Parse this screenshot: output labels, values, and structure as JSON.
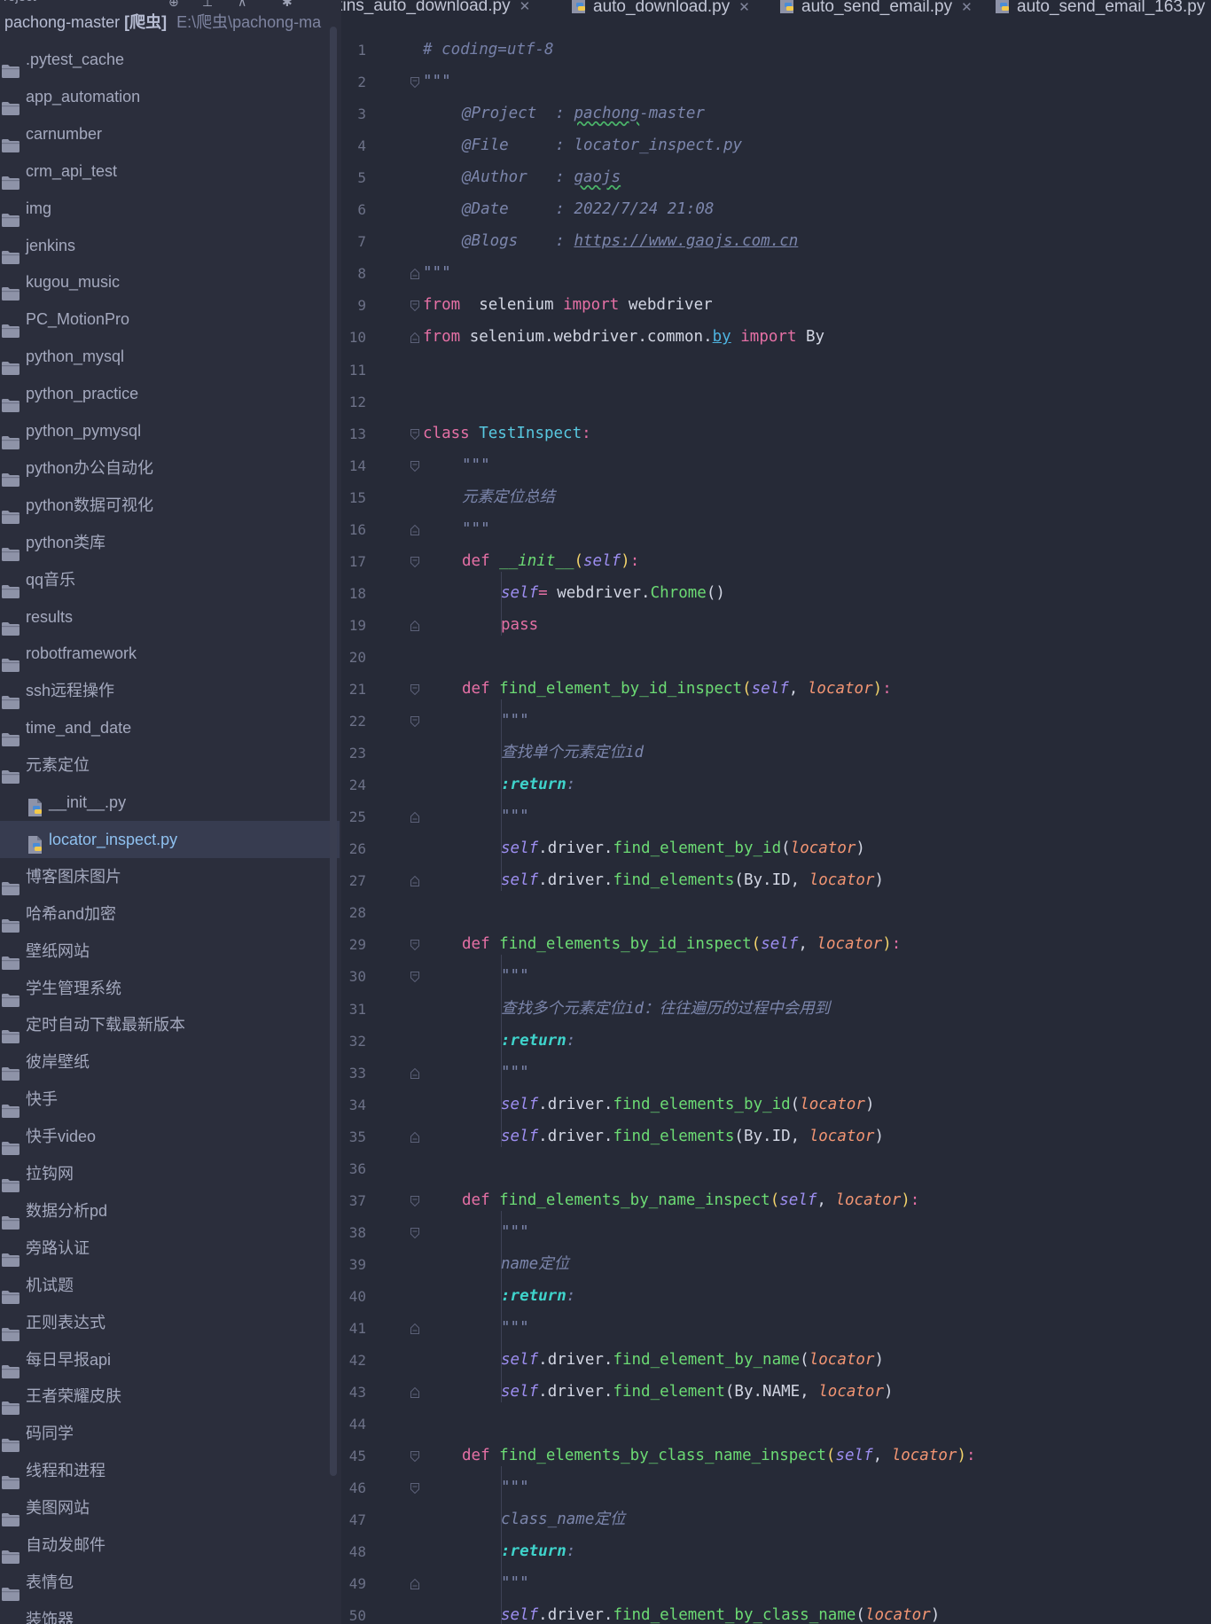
{
  "sidebar": {
    "header_label": "roject",
    "root": {
      "name": "pachong-master",
      "dir": "[爬虫]",
      "path": "E:\\爬虫\\pachong-ma"
    },
    "items": [
      {
        "label": ".pytest_cache",
        "type": "folder"
      },
      {
        "label": "app_automation",
        "type": "folder"
      },
      {
        "label": "carnumber",
        "type": "folder"
      },
      {
        "label": "crm_api_test",
        "type": "folder"
      },
      {
        "label": "img",
        "type": "folder"
      },
      {
        "label": "jenkins",
        "type": "folder"
      },
      {
        "label": "kugou_music",
        "type": "folder"
      },
      {
        "label": "PC_MotionPro",
        "type": "folder"
      },
      {
        "label": "python_mysql",
        "type": "folder"
      },
      {
        "label": "python_practice",
        "type": "folder"
      },
      {
        "label": "python_pymysql",
        "type": "folder"
      },
      {
        "label": "python办公自动化",
        "type": "folder"
      },
      {
        "label": "python数据可视化",
        "type": "folder"
      },
      {
        "label": "python类库",
        "type": "folder"
      },
      {
        "label": "qq音乐",
        "type": "folder"
      },
      {
        "label": "results",
        "type": "folder"
      },
      {
        "label": "robotframework",
        "type": "folder"
      },
      {
        "label": "ssh远程操作",
        "type": "folder"
      },
      {
        "label": "time_and_date",
        "type": "folder"
      },
      {
        "label": "元素定位",
        "type": "folder"
      },
      {
        "label": "__init__.py",
        "type": "file"
      },
      {
        "label": "locator_inspect.py",
        "type": "file",
        "selected": true
      },
      {
        "label": "博客图床图片",
        "type": "folder"
      },
      {
        "label": "哈希and加密",
        "type": "folder"
      },
      {
        "label": "壁纸网站",
        "type": "folder"
      },
      {
        "label": "学生管理系统",
        "type": "folder"
      },
      {
        "label": "定时自动下载最新版本",
        "type": "folder"
      },
      {
        "label": "彼岸壁纸",
        "type": "folder"
      },
      {
        "label": "快手",
        "type": "folder"
      },
      {
        "label": "快手video",
        "type": "folder"
      },
      {
        "label": "拉钩网",
        "type": "folder"
      },
      {
        "label": "数据分析pd",
        "type": "folder"
      },
      {
        "label": "旁路认证",
        "type": "folder"
      },
      {
        "label": "机试题",
        "type": "folder"
      },
      {
        "label": "正则表达式",
        "type": "folder"
      },
      {
        "label": "每日早报api",
        "type": "folder"
      },
      {
        "label": "王者荣耀皮肤",
        "type": "folder"
      },
      {
        "label": "码同学",
        "type": "folder"
      },
      {
        "label": "线程和进程",
        "type": "folder"
      },
      {
        "label": "美图网站",
        "type": "folder"
      },
      {
        "label": "自动发邮件",
        "type": "folder"
      },
      {
        "label": "表情包",
        "type": "folder"
      },
      {
        "label": "装饰器",
        "type": "folder"
      }
    ]
  },
  "tabs": [
    {
      "label": "kins_auto_download.py",
      "icon": false
    },
    {
      "label": "auto_download.py",
      "icon": true
    },
    {
      "label": "auto_send_email.py",
      "icon": true
    },
    {
      "label": "auto_send_email_163.py",
      "icon": true
    }
  ],
  "code_lines": [
    {
      "n": "1",
      "indent": 0,
      "fold": "",
      "tokens": [
        [
          "c-cmt",
          "# coding=utf-8"
        ]
      ]
    },
    {
      "n": "2",
      "indent": 0,
      "fold": "open",
      "tokens": [
        [
          "c-doc",
          "\"\"\""
        ]
      ]
    },
    {
      "n": "3",
      "indent": 1,
      "fold": "",
      "tokens": [
        [
          "c-doc",
          "@Project  : "
        ],
        [
          "c-doc c-wavy",
          "pachong"
        ],
        [
          "c-doc",
          "-master"
        ]
      ]
    },
    {
      "n": "4",
      "indent": 1,
      "fold": "",
      "tokens": [
        [
          "c-doc",
          "@File     : locator_inspect.py"
        ]
      ]
    },
    {
      "n": "5",
      "indent": 1,
      "fold": "",
      "tokens": [
        [
          "c-doc",
          "@Author   : "
        ],
        [
          "c-doc c-wavy",
          "gaojs"
        ]
      ]
    },
    {
      "n": "6",
      "indent": 1,
      "fold": "",
      "tokens": [
        [
          "c-doc",
          "@Date     : 2022/7/24 21:08"
        ]
      ]
    },
    {
      "n": "7",
      "indent": 1,
      "fold": "",
      "tokens": [
        [
          "c-doc",
          "@Blogs    : "
        ],
        [
          "c-doc c-link",
          "https://www.gaojs.com.cn"
        ]
      ]
    },
    {
      "n": "8",
      "indent": 0,
      "fold": "close",
      "tokens": [
        [
          "c-doc",
          "\"\"\""
        ]
      ]
    },
    {
      "n": "9",
      "indent": 0,
      "fold": "open",
      "tokens": [
        [
          "c-kw",
          "from"
        ],
        [
          "",
          "  selenium "
        ],
        [
          "c-kw",
          "import"
        ],
        [
          "",
          " webdriver"
        ]
      ]
    },
    {
      "n": "10",
      "indent": 0,
      "fold": "close",
      "tokens": [
        [
          "c-kw",
          "from"
        ],
        [
          "",
          " selenium.webdriver.common."
        ],
        [
          "c-uline",
          "by"
        ],
        [
          "",
          " "
        ],
        [
          "c-kw",
          "import"
        ],
        [
          "",
          " By"
        ]
      ]
    },
    {
      "n": "11",
      "indent": 0,
      "fold": "",
      "tokens": []
    },
    {
      "n": "12",
      "indent": 0,
      "fold": "",
      "tokens": []
    },
    {
      "n": "13",
      "indent": 0,
      "fold": "open",
      "tokens": [
        [
          "c-kw",
          "class"
        ],
        [
          "",
          " "
        ],
        [
          "c-cls",
          "TestInspect"
        ],
        [
          "c-kw",
          ":"
        ]
      ]
    },
    {
      "n": "14",
      "indent": 1,
      "fold": "open",
      "tokens": [
        [
          "c-doc",
          "\"\"\""
        ]
      ]
    },
    {
      "n": "15",
      "indent": 1,
      "fold": "",
      "tokens": [
        [
          "c-doc",
          "元素定位总结"
        ]
      ]
    },
    {
      "n": "16",
      "indent": 1,
      "fold": "close",
      "tokens": [
        [
          "c-doc",
          "\"\"\""
        ]
      ]
    },
    {
      "n": "17",
      "indent": 1,
      "fold": "open",
      "tokens": [
        [
          "c-kw",
          "def"
        ],
        [
          "",
          " "
        ],
        [
          "c-dunder",
          "__init__"
        ],
        [
          "c-paren",
          "("
        ],
        [
          "c-self",
          "self"
        ],
        [
          "c-paren",
          ")"
        ],
        [
          "c-kw",
          ":"
        ]
      ]
    },
    {
      "n": "18",
      "indent": 2,
      "fold": "",
      "tokens": [
        [
          "c-self",
          "self"
        ],
        [
          ".driver "
        ],
        [
          "c-kw",
          "="
        ],
        [
          "",
          " webdriver."
        ],
        [
          "c-fn",
          "Chrome"
        ],
        [
          "",
          "()"
        ]
      ]
    },
    {
      "n": "19",
      "indent": 2,
      "fold": "close",
      "tokens": [
        [
          "c-kw",
          "pass"
        ]
      ]
    },
    {
      "n": "20",
      "indent": 0,
      "fold": "",
      "tokens": []
    },
    {
      "n": "21",
      "indent": 1,
      "fold": "open",
      "tokens": [
        [
          "c-kw",
          "def"
        ],
        [
          "",
          " "
        ],
        [
          "c-fn",
          "find_element_by_id_inspect"
        ],
        [
          "c-paren",
          "("
        ],
        [
          "c-self",
          "self"
        ],
        [
          "",
          ", "
        ],
        [
          "c-param",
          "locator"
        ],
        [
          "c-paren",
          ")"
        ],
        [
          "c-kw",
          ":"
        ]
      ]
    },
    {
      "n": "22",
      "indent": 2,
      "fold": "open",
      "tokens": [
        [
          "c-doc",
          "\"\"\""
        ]
      ]
    },
    {
      "n": "23",
      "indent": 2,
      "fold": "",
      "tokens": [
        [
          "c-doc",
          "查找单个元素定位id"
        ]
      ]
    },
    {
      "n": "24",
      "indent": 2,
      "fold": "",
      "tokens": [
        [
          "c-ret",
          ":return"
        ],
        [
          "c-doc",
          ":"
        ]
      ]
    },
    {
      "n": "25",
      "indent": 2,
      "fold": "close",
      "tokens": [
        [
          "c-doc",
          "\"\"\""
        ]
      ]
    },
    {
      "n": "26",
      "indent": 2,
      "fold": "",
      "tokens": [
        [
          "c-self",
          "self"
        ],
        [
          "",
          ".driver."
        ],
        [
          "c-fn",
          "find_element_by_id"
        ],
        [
          "",
          "("
        ],
        [
          "c-param",
          "locator"
        ],
        [
          "",
          ")"
        ]
      ]
    },
    {
      "n": "27",
      "indent": 2,
      "fold": "close",
      "tokens": [
        [
          "c-self",
          "self"
        ],
        [
          "",
          ".driver."
        ],
        [
          "c-fn",
          "find_elements"
        ],
        [
          "",
          "(By.ID, "
        ],
        [
          "c-param",
          "locator"
        ],
        [
          "",
          ")"
        ]
      ]
    },
    {
      "n": "28",
      "indent": 0,
      "fold": "",
      "tokens": []
    },
    {
      "n": "29",
      "indent": 1,
      "fold": "open",
      "tokens": [
        [
          "c-kw",
          "def"
        ],
        [
          "",
          " "
        ],
        [
          "c-fn",
          "find_elements_by_id_inspect"
        ],
        [
          "c-paren",
          "("
        ],
        [
          "c-self",
          "self"
        ],
        [
          "",
          ", "
        ],
        [
          "c-param",
          "locator"
        ],
        [
          "c-paren",
          ")"
        ],
        [
          "c-kw",
          ":"
        ]
      ]
    },
    {
      "n": "30",
      "indent": 2,
      "fold": "open",
      "tokens": [
        [
          "c-doc",
          "\"\"\""
        ]
      ]
    },
    {
      "n": "31",
      "indent": 2,
      "fold": "",
      "tokens": [
        [
          "c-doc",
          "查找多个元素定位id：往往遍历的过程中会用到"
        ]
      ]
    },
    {
      "n": "32",
      "indent": 2,
      "fold": "",
      "tokens": [
        [
          "c-ret",
          ":return"
        ],
        [
          "c-doc",
          ":"
        ]
      ]
    },
    {
      "n": "33",
      "indent": 2,
      "fold": "close",
      "tokens": [
        [
          "c-doc",
          "\"\"\""
        ]
      ]
    },
    {
      "n": "34",
      "indent": 2,
      "fold": "",
      "tokens": [
        [
          "c-self",
          "self"
        ],
        [
          "",
          ".driver."
        ],
        [
          "c-fn",
          "find_elements_by_id"
        ],
        [
          "",
          "("
        ],
        [
          "c-param",
          "locator"
        ],
        [
          "",
          ")"
        ]
      ]
    },
    {
      "n": "35",
      "indent": 2,
      "fold": "close",
      "tokens": [
        [
          "c-self",
          "self"
        ],
        [
          "",
          ".driver."
        ],
        [
          "c-fn",
          "find_elements"
        ],
        [
          "",
          "(By.ID, "
        ],
        [
          "c-param",
          "locator"
        ],
        [
          "",
          ")"
        ]
      ]
    },
    {
      "n": "36",
      "indent": 0,
      "fold": "",
      "tokens": []
    },
    {
      "n": "37",
      "indent": 1,
      "fold": "open",
      "tokens": [
        [
          "c-kw",
          "def"
        ],
        [
          "",
          " "
        ],
        [
          "c-fn",
          "find_elements_by_name_inspect"
        ],
        [
          "c-paren",
          "("
        ],
        [
          "c-self",
          "self"
        ],
        [
          "",
          ", "
        ],
        [
          "c-param",
          "locator"
        ],
        [
          "c-paren",
          ")"
        ],
        [
          "c-kw",
          ":"
        ]
      ]
    },
    {
      "n": "38",
      "indent": 2,
      "fold": "open",
      "tokens": [
        [
          "c-doc",
          "\"\"\""
        ]
      ]
    },
    {
      "n": "39",
      "indent": 2,
      "fold": "",
      "tokens": [
        [
          "c-doc",
          "name定位"
        ]
      ]
    },
    {
      "n": "40",
      "indent": 2,
      "fold": "",
      "tokens": [
        [
          "c-ret",
          ":return"
        ],
        [
          "c-doc",
          ":"
        ]
      ]
    },
    {
      "n": "41",
      "indent": 2,
      "fold": "close",
      "tokens": [
        [
          "c-doc",
          "\"\"\""
        ]
      ]
    },
    {
      "n": "42",
      "indent": 2,
      "fold": "",
      "tokens": [
        [
          "c-self",
          "self"
        ],
        [
          "",
          ".driver."
        ],
        [
          "c-fn",
          "find_element_by_name"
        ],
        [
          "",
          "("
        ],
        [
          "c-param",
          "locator"
        ],
        [
          "",
          ")"
        ]
      ]
    },
    {
      "n": "43",
      "indent": 2,
      "fold": "close",
      "tokens": [
        [
          "c-self",
          "self"
        ],
        [
          "",
          ".driver."
        ],
        [
          "c-fn",
          "find_element"
        ],
        [
          "",
          "(By.NAME, "
        ],
        [
          "c-param",
          "locator"
        ],
        [
          "",
          ")"
        ]
      ]
    },
    {
      "n": "44",
      "indent": 0,
      "fold": "",
      "tokens": []
    },
    {
      "n": "45",
      "indent": 1,
      "fold": "open",
      "tokens": [
        [
          "c-kw",
          "def"
        ],
        [
          "",
          " "
        ],
        [
          "c-fn",
          "find_elements_by_class_name_inspect"
        ],
        [
          "c-paren",
          "("
        ],
        [
          "c-self",
          "self"
        ],
        [
          "",
          ", "
        ],
        [
          "c-param",
          "locator"
        ],
        [
          "c-paren",
          ")"
        ],
        [
          "c-kw",
          ":"
        ]
      ]
    },
    {
      "n": "46",
      "indent": 2,
      "fold": "open",
      "tokens": [
        [
          "c-doc",
          "\"\"\""
        ]
      ]
    },
    {
      "n": "47",
      "indent": 2,
      "fold": "",
      "tokens": [
        [
          "c-doc",
          "class_name定位"
        ]
      ]
    },
    {
      "n": "48",
      "indent": 2,
      "fold": "",
      "tokens": [
        [
          "c-ret",
          ":return"
        ],
        [
          "c-doc",
          ":"
        ]
      ]
    },
    {
      "n": "49",
      "indent": 2,
      "fold": "close",
      "tokens": [
        [
          "c-doc",
          "\"\"\""
        ]
      ]
    },
    {
      "n": "50",
      "indent": 2,
      "fold": "",
      "tokens": [
        [
          "c-self",
          "self"
        ],
        [
          "",
          ".driver."
        ],
        [
          "c-fn",
          "find_element_by_class_name"
        ],
        [
          "",
          "("
        ],
        [
          "c-param",
          "locator"
        ],
        [
          "",
          ")"
        ]
      ]
    }
  ],
  "colors": {
    "editor_bg": "#262A37",
    "sidebar_bg": "#2B2E3C",
    "selected_row": "#373C50",
    "keyword": "#E570A5",
    "function": "#6CDB74",
    "param": "#F29573",
    "self": "#9D8EF0"
  }
}
